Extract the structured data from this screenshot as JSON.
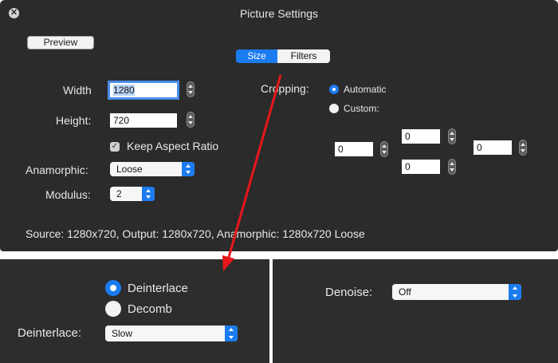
{
  "window": {
    "title": "Picture Settings"
  },
  "toolbar": {
    "preview_label": "Preview"
  },
  "tabs": [
    {
      "label": "Size"
    },
    {
      "label": "Filters"
    }
  ],
  "size": {
    "width_label": "Width",
    "width_value": "1280",
    "height_label": "Height:",
    "height_value": "720",
    "keep_aspect_label": "Keep Aspect Ratio",
    "anamorphic_label": "Anamorphic:",
    "anamorphic_value": "Loose",
    "modulus_label": "Modulus:",
    "modulus_value": "2"
  },
  "cropping": {
    "label": "Cropping:",
    "automatic_label": "Automatic",
    "custom_label": "Custom:",
    "top": "0",
    "bottom": "0",
    "left": "0",
    "right": "0"
  },
  "status": {
    "text": "Source: 1280x720, Output: 1280x720, Anamorphic: 1280x720 Loose"
  },
  "filters": {
    "deinterlace_radio_label": "Deinterlace",
    "decomb_radio_label": "Decomb",
    "deinterlace_label": "Deinterlace:",
    "deinterlace_value": "Slow",
    "denoise_label": "Denoise:",
    "denoise_value": "Off"
  },
  "colors": {
    "accent": "#1b7cf1",
    "panel": "#2b2b2b",
    "annotation_arrow": "#e8161a"
  }
}
